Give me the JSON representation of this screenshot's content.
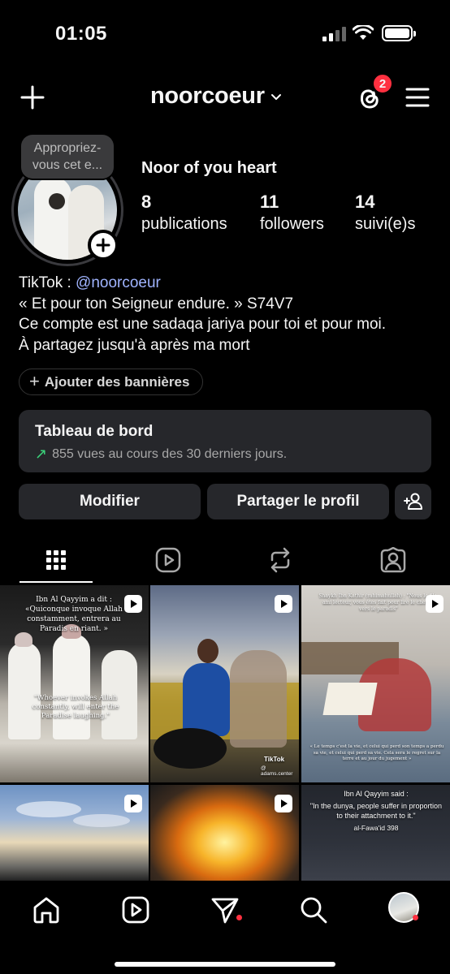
{
  "status": {
    "time": "01:05"
  },
  "header": {
    "username": "noorcoeur",
    "notifications_count": "2"
  },
  "profile": {
    "note": "Appropriez-vous cet e...",
    "display_name": "Noor of you heart",
    "stats": [
      {
        "value": "8",
        "label": "publications"
      },
      {
        "value": "11",
        "label": "followers"
      },
      {
        "value": "14",
        "label": "suivi(e)s"
      }
    ],
    "bio": {
      "line1_prefix": "TikTok : ",
      "line1_link": "@noorcoeur",
      "line2": "« Et pour ton Seigneur endure. » S74V7",
      "line3": "Ce compte est une sadaqa jariya pour toi et pour moi.",
      "line4": "À partagez jusqu'à après ma mort"
    },
    "banners_button": "Ajouter des bannières",
    "dashboard": {
      "title": "Tableau de bord",
      "subtitle": "855 vues au cours des 30 derniers jours."
    },
    "buttons": {
      "edit": "Modifier",
      "share": "Partager le profil"
    }
  },
  "tabs": [
    {
      "icon": "grid-icon",
      "active": true
    },
    {
      "icon": "reels-icon",
      "active": false
    },
    {
      "icon": "reposts-icon",
      "active": false
    },
    {
      "icon": "tagged-icon",
      "active": false
    }
  ],
  "posts": [
    {
      "caption_top": "Ibn Al Qayyim a dit : «Quiconque invoque Allah constamment, entrera au Paradis en riant. »",
      "caption_bottom": "\"Whoever invokes Allah constantly, will enter the Paradise laughing.\""
    },
    {
      "watermark_brand": "TikTok",
      "watermark_handle": "@ adams.center"
    },
    {
      "caption_top": "Shaykh Ibn Kathir (rahimahullah) : \"Nous le fils, ami lecteur, vous êtes fait pour lire le chemin vers le paradis\"",
      "caption_bottom": "« Le temps c'est la vie, et celui qui perd son temps a perdu sa vie, et celui qui perd sa vie. Cela sera le regret sur la terre et au jour du jugement »"
    },
    {
      "caption": ""
    },
    {
      "caption": ""
    },
    {
      "title": "Ibn Al Qayyim said :",
      "quote": "\"In the dunya, people suffer in proportion to their attachment to it.\"",
      "source": "al-Fawa'id 398"
    }
  ],
  "bottom_nav": [
    "home-icon",
    "reels-icon",
    "messages-icon",
    "search-icon",
    "profile-avatar"
  ],
  "colors": {
    "background": "#000000",
    "card": "#26272b",
    "link": "#a0b4ff",
    "badge": "#ff3040",
    "trend": "#3bd47b"
  }
}
